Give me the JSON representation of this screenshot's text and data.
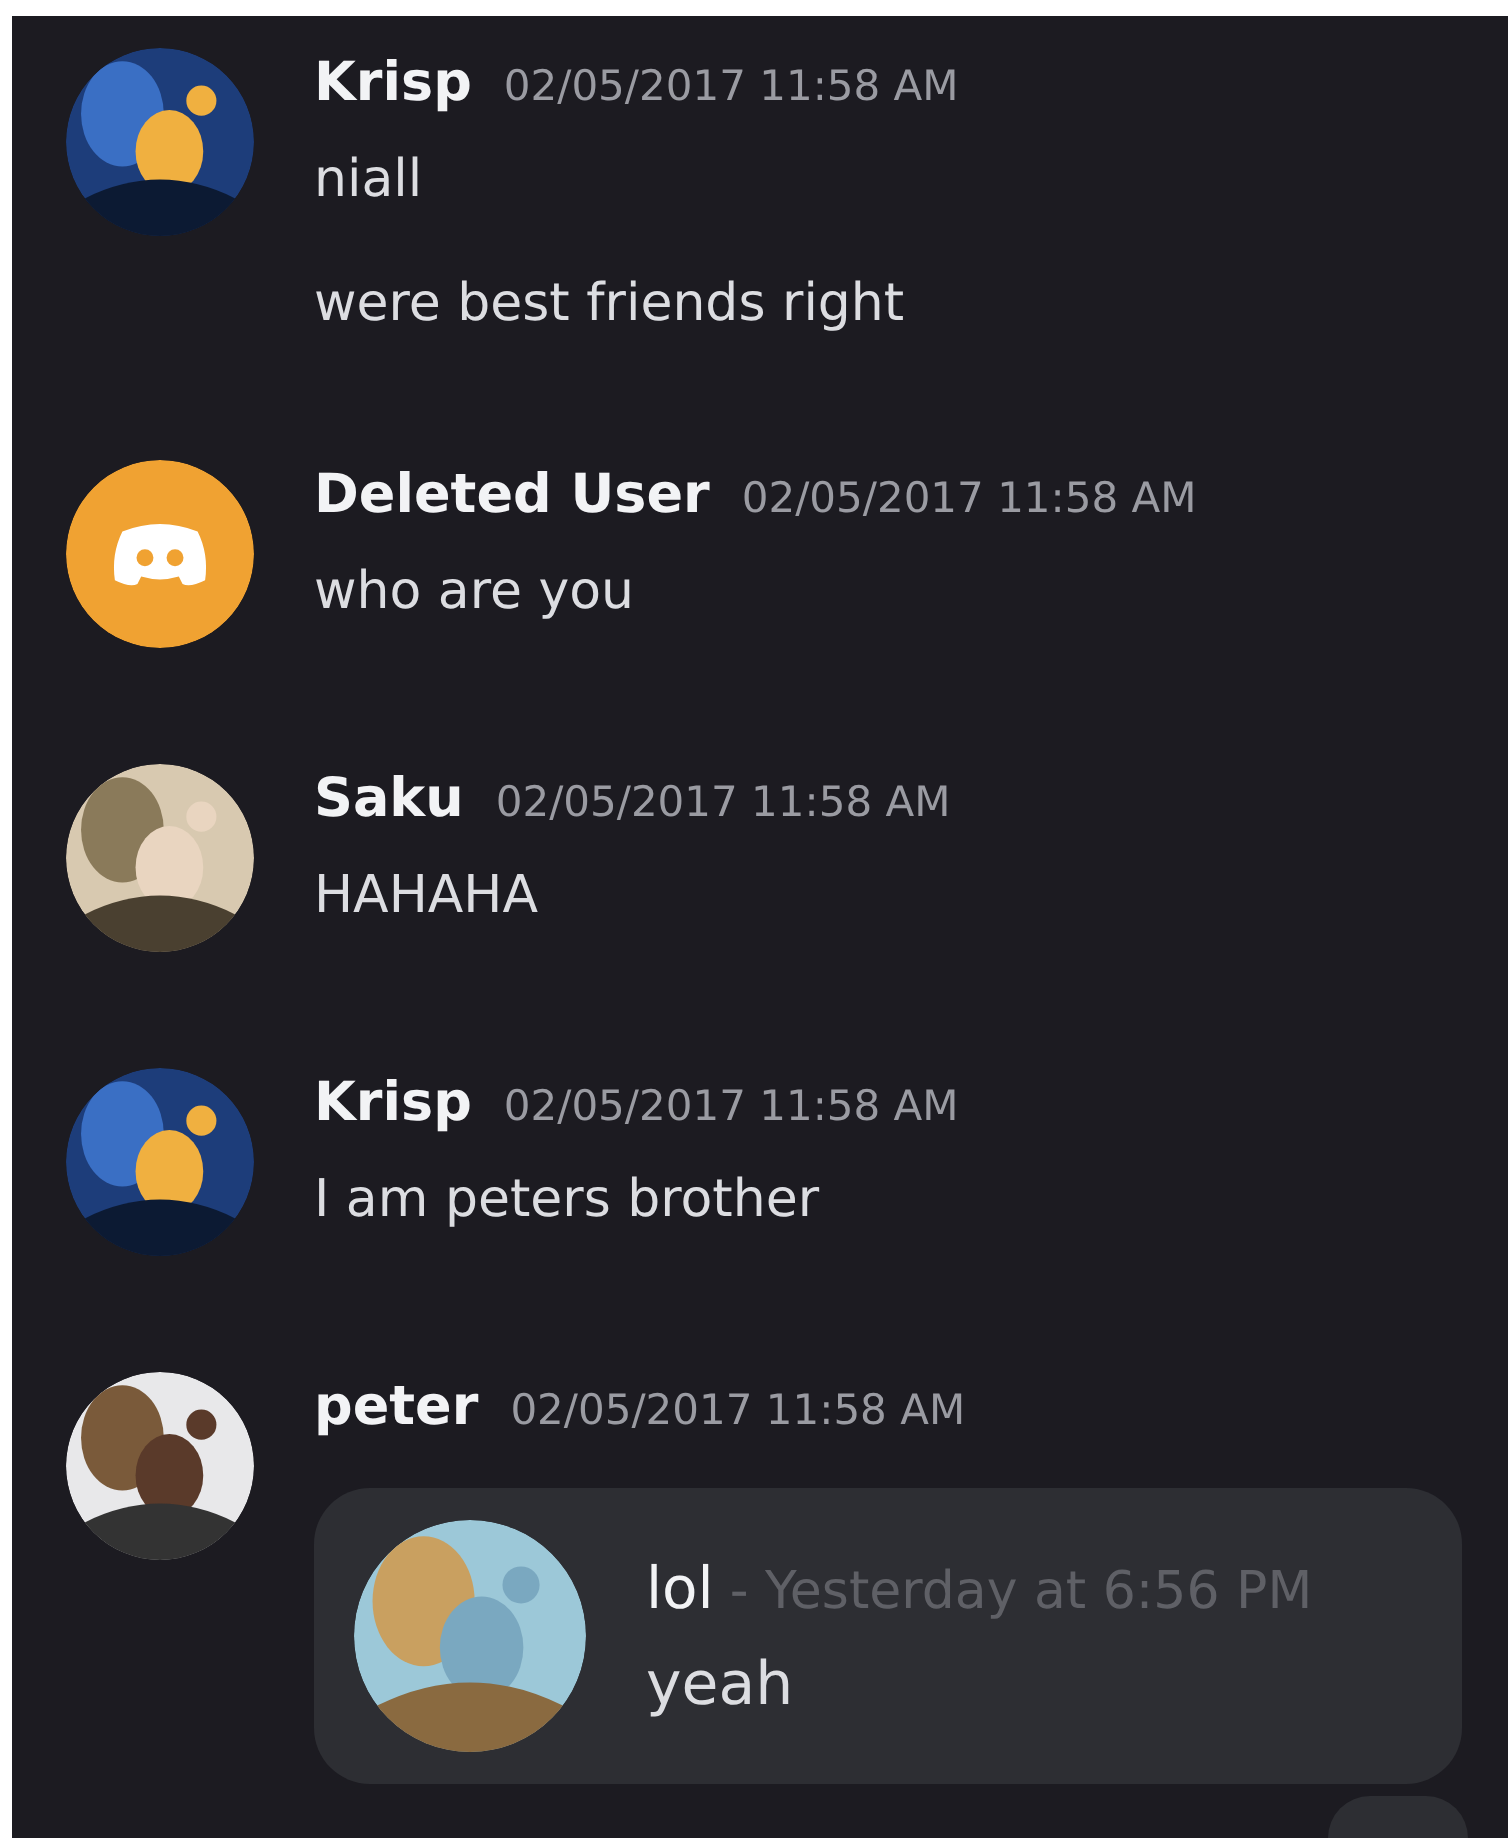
{
  "messages": [
    {
      "author": "Krisp",
      "timestamp": "02/05/2017 11:58 AM",
      "avatar": {
        "kind": "picture"
      },
      "lines": [
        "niall",
        "were best friends right"
      ]
    },
    {
      "author": "Deleted User",
      "timestamp": "02/05/2017 11:58 AM",
      "avatar": {
        "kind": "default",
        "color": "#f0a232"
      },
      "lines": [
        "who are you"
      ]
    },
    {
      "author": "Saku",
      "timestamp": "02/05/2017 11:58 AM",
      "avatar": {
        "kind": "picture"
      },
      "lines": [
        "HAHAHA"
      ]
    },
    {
      "author": "Krisp",
      "timestamp": "02/05/2017 11:58 AM",
      "avatar": {
        "kind": "picture"
      },
      "lines": [
        "I am peters brother"
      ]
    },
    {
      "author": "peter",
      "timestamp": "02/05/2017 11:58 AM",
      "avatar": {
        "kind": "picture"
      },
      "embed": {
        "author": "lol",
        "time": "- Yesterday at 6:56 PM",
        "text": "yeah",
        "avatar": {
          "kind": "picture"
        }
      }
    }
  ]
}
